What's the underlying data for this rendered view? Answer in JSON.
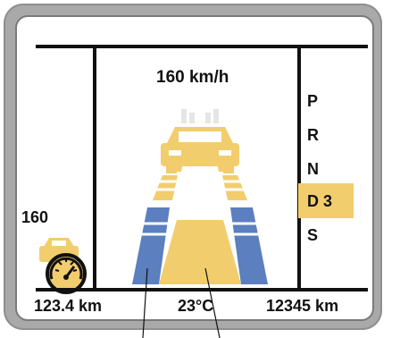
{
  "colors": {
    "accent": "#f2cd6e",
    "lane": "#5b7fbf",
    "frame": "#a9a9a9"
  },
  "display": {
    "speed_readout": "160 km/h",
    "speed_limit": "160",
    "odometer": "123.4 km",
    "temperature": "23°C",
    "trip": "12345 km"
  },
  "gears": {
    "items": [
      "P",
      "R",
      "N",
      "D 3",
      "S"
    ],
    "active": "D 3"
  },
  "icons": {
    "car_ahead": "car-icon",
    "small_car": "car-icon",
    "speedometer": "speedometer-icon"
  }
}
